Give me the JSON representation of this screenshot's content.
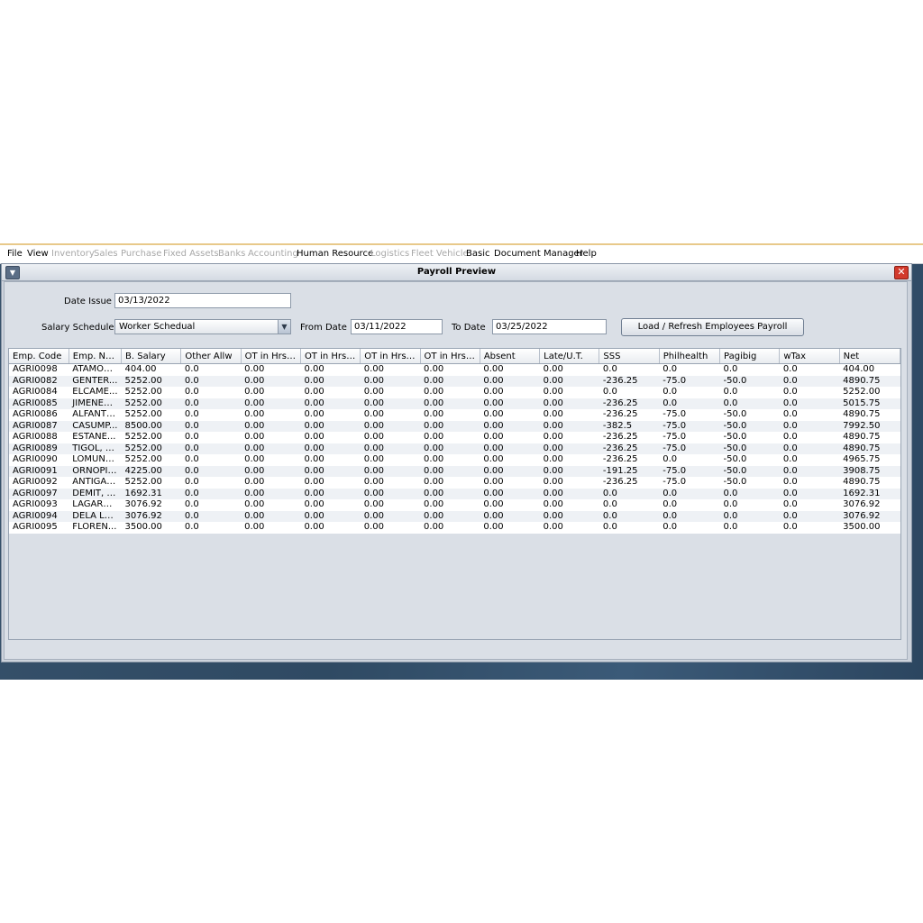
{
  "menu": [
    {
      "label": "File",
      "enabled": true
    },
    {
      "label": "View",
      "enabled": true
    },
    {
      "label": "Inventory",
      "enabled": false
    },
    {
      "label": "Sales",
      "enabled": false
    },
    {
      "label": "Purchase",
      "enabled": false
    },
    {
      "label": "Fixed Assets",
      "enabled": false
    },
    {
      "label": "Banks",
      "enabled": false
    },
    {
      "label": "Accounting",
      "enabled": false
    },
    {
      "label": "Human Resource",
      "enabled": true
    },
    {
      "label": "Logistics",
      "enabled": false
    },
    {
      "label": "Fleet Vehicle",
      "enabled": false
    },
    {
      "label": "Basic",
      "enabled": true
    },
    {
      "label": "Document Manager",
      "enabled": true
    },
    {
      "label": "Help",
      "enabled": true
    }
  ],
  "window": {
    "title": "Payroll Preview"
  },
  "form": {
    "date_issue_label": "Date Issue",
    "date_issue_value": "03/13/2022",
    "salary_schedule_label": "Salary Schedule",
    "salary_schedule_value": "Worker Schedual",
    "from_date_label": "From Date",
    "from_date_value": "03/11/2022",
    "to_date_label": "To Date",
    "to_date_value": "03/25/2022",
    "load_button": "Load / Refresh Employees Payroll"
  },
  "table": {
    "columns": [
      "Emp. Code",
      "Emp. Name",
      "B. Salary",
      "Other Allw",
      "OT in Hrs (2...",
      "OT in Hrs (3...",
      "OT in Hrs (5...",
      "OT in Hrs (1...",
      "Absent",
      "Late/U.T.",
      "SSS",
      "Philhealth",
      "Pagibig",
      "wTax",
      "Net"
    ],
    "rows": [
      [
        "AGRI0098",
        "ATAMOS...",
        "404.00",
        "0.0",
        "0.00",
        "0.00",
        "0.00",
        "0.00",
        "0.00",
        "0.00",
        "0.0",
        "0.0",
        "0.0",
        "0.0",
        "404.00"
      ],
      [
        "AGRI0082",
        "GENTER...",
        "5252.00",
        "0.0",
        "0.00",
        "0.00",
        "0.00",
        "0.00",
        "0.00",
        "0.00",
        "-236.25",
        "-75.0",
        "-50.0",
        "0.0",
        "4890.75"
      ],
      [
        "AGRI0084",
        "ELCAME...",
        "5252.00",
        "0.0",
        "0.00",
        "0.00",
        "0.00",
        "0.00",
        "0.00",
        "0.00",
        "0.0",
        "0.0",
        "0.0",
        "0.0",
        "5252.00"
      ],
      [
        "AGRI0085",
        "JIMENEZ...",
        "5252.00",
        "0.0",
        "0.00",
        "0.00",
        "0.00",
        "0.00",
        "0.00",
        "0.00",
        "-236.25",
        "0.0",
        "0.0",
        "0.0",
        "5015.75"
      ],
      [
        "AGRI0086",
        "ALFANTE...",
        "5252.00",
        "0.0",
        "0.00",
        "0.00",
        "0.00",
        "0.00",
        "0.00",
        "0.00",
        "-236.25",
        "-75.0",
        "-50.0",
        "0.0",
        "4890.75"
      ],
      [
        "AGRI0087",
        "CASUMP...",
        "8500.00",
        "0.0",
        "0.00",
        "0.00",
        "0.00",
        "0.00",
        "0.00",
        "0.00",
        "-382.5",
        "-75.0",
        "-50.0",
        "0.0",
        "7992.50"
      ],
      [
        "AGRI0088",
        "ESTANE...",
        "5252.00",
        "0.0",
        "0.00",
        "0.00",
        "0.00",
        "0.00",
        "0.00",
        "0.00",
        "-236.25",
        "-75.0",
        "-50.0",
        "0.0",
        "4890.75"
      ],
      [
        "AGRI0089",
        "TIGOL, MI...",
        "5252.00",
        "0.0",
        "0.00",
        "0.00",
        "0.00",
        "0.00",
        "0.00",
        "0.00",
        "-236.25",
        "-75.0",
        "-50.0",
        "0.0",
        "4890.75"
      ],
      [
        "AGRI0090",
        "LOMUNT...",
        "5252.00",
        "0.0",
        "0.00",
        "0.00",
        "0.00",
        "0.00",
        "0.00",
        "0.00",
        "-236.25",
        "0.0",
        "-50.0",
        "0.0",
        "4965.75"
      ],
      [
        "AGRI0091",
        "ORNOPIA...",
        "4225.00",
        "0.0",
        "0.00",
        "0.00",
        "0.00",
        "0.00",
        "0.00",
        "0.00",
        "-191.25",
        "-75.0",
        "-50.0",
        "0.0",
        "3908.75"
      ],
      [
        "AGRI0092",
        "ANTIGA, ...",
        "5252.00",
        "0.0",
        "0.00",
        "0.00",
        "0.00",
        "0.00",
        "0.00",
        "0.00",
        "-236.25",
        "-75.0",
        "-50.0",
        "0.0",
        "4890.75"
      ],
      [
        "AGRI0097",
        "DEMIT, R...",
        "1692.31",
        "0.0",
        "0.00",
        "0.00",
        "0.00",
        "0.00",
        "0.00",
        "0.00",
        "0.0",
        "0.0",
        "0.0",
        "0.0",
        "1692.31"
      ],
      [
        "AGRI0093",
        "LAGARNI...",
        "3076.92",
        "0.0",
        "0.00",
        "0.00",
        "0.00",
        "0.00",
        "0.00",
        "0.00",
        "0.0",
        "0.0",
        "0.0",
        "0.0",
        "3076.92"
      ],
      [
        "AGRI0094",
        "DELA LE...",
        "3076.92",
        "0.0",
        "0.00",
        "0.00",
        "0.00",
        "0.00",
        "0.00",
        "0.00",
        "0.0",
        "0.0",
        "0.0",
        "0.0",
        "3076.92"
      ],
      [
        "AGRI0095",
        "FLOREN...",
        "3500.00",
        "0.0",
        "0.00",
        "0.00",
        "0.00",
        "0.00",
        "0.00",
        "0.00",
        "0.0",
        "0.0",
        "0.0",
        "0.0",
        "3500.00"
      ]
    ]
  },
  "icons": {
    "window_menu": "chevron-down-icon",
    "close": "close-icon",
    "combo_arrow": "triangle-down-icon"
  }
}
